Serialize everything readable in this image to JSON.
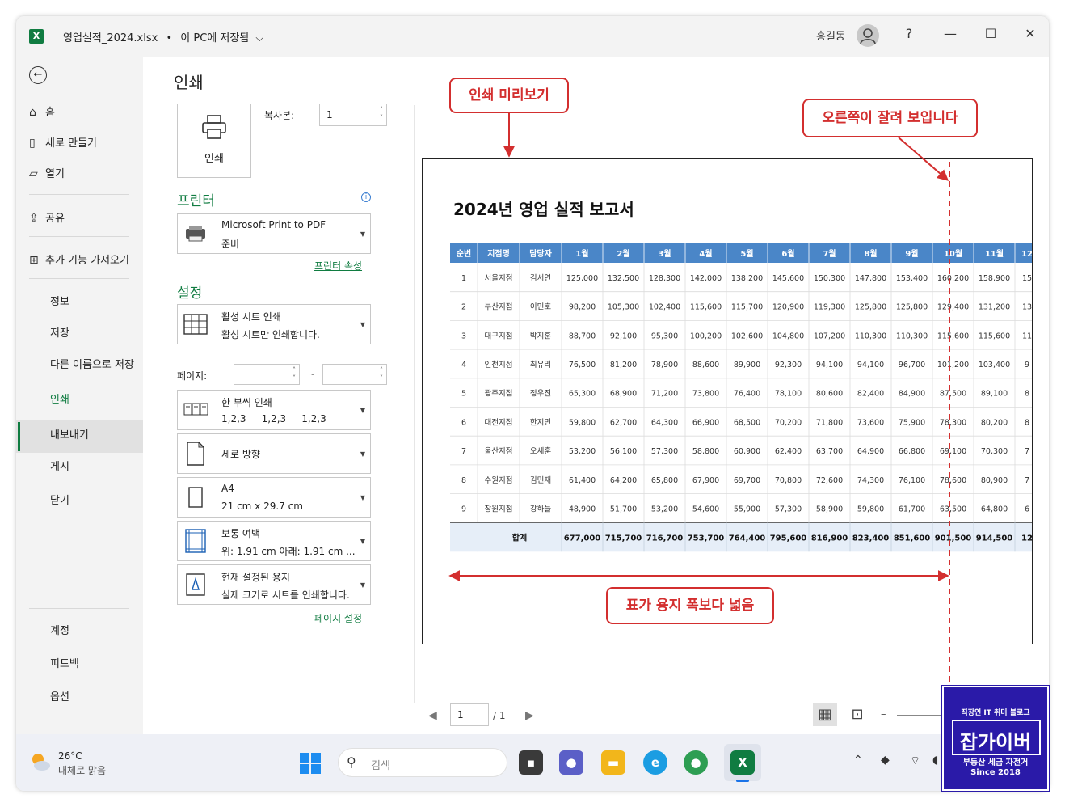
{
  "titlebar": {
    "filename": "영업실적_2024.xlsx",
    "separator": "•",
    "save_status": "이 PC에 저장됨",
    "dropdown_glyph": "⌵",
    "user": "홍길동",
    "help": "?",
    "minimize": "—",
    "maximize": "☐",
    "close": "✕"
  },
  "nav": {
    "back_glyph": "←",
    "items": [
      {
        "icon": "⌂",
        "label": "홈"
      },
      {
        "icon": "▯",
        "label": "새로 만들기"
      },
      {
        "icon": "▱",
        "label": "열기"
      },
      {
        "icon": "⇪",
        "label": "공유"
      },
      {
        "icon": "⊞",
        "label": "추가 기능 가져오기"
      }
    ],
    "plain_items": [
      "정보",
      "저장",
      "다른 이름으로 저장",
      "인쇄",
      "내보내기",
      "게시",
      "닫기"
    ],
    "bottom_items": [
      "계정",
      "피드백",
      "옵션"
    ],
    "active": "인쇄"
  },
  "print": {
    "title": "인쇄",
    "button_label": "인쇄",
    "copies_label": "복사본:",
    "copies_value": "1",
    "printer_section": "프린터",
    "printer_name": "Microsoft Print to PDF",
    "printer_status": "준비",
    "printer_props_link": "프린터 속성",
    "settings_section": "설정",
    "settings": [
      {
        "l1": "활성 시트 인쇄",
        "l2": "활성 시트만 인쇄합니다."
      },
      {
        "l1": "한 부씩 인쇄",
        "l2": "1,2,3     1,2,3     1,2,3"
      },
      {
        "l1": "세로 방향",
        "l2": ""
      },
      {
        "l1": "A4",
        "l2": "21 cm x 29.7 cm"
      },
      {
        "l1": "보통 여백",
        "l2": "위: 1.91 cm   아래: 1.91 cm ..."
      },
      {
        "l1": "현재 설정된 용지",
        "l2": "실제 크기로 시트를 인쇄합니다."
      }
    ],
    "pages_label": "페이지:",
    "pages_tilde": "~",
    "page_setup_link": "페이지 설정"
  },
  "preview": {
    "report_title": "2024년 영업 실적 보고서",
    "page_current": "1",
    "page_total": "/ 1"
  },
  "callouts": {
    "preview": "인쇄 미리보기",
    "cut": "오른쪽이 잘려 보입니다",
    "wide": "표가 용지 폭보다 넓음"
  },
  "chart_data": {
    "type": "table",
    "columns": [
      "순번",
      "지점명",
      "담당자",
      "1월",
      "2월",
      "3월",
      "4월",
      "5월",
      "6월",
      "7월",
      "8월",
      "9월",
      "10월",
      "11월",
      "12"
    ],
    "rows": [
      [
        "1",
        "서울지점",
        "김서연",
        "125,000",
        "132,500",
        "128,300",
        "142,000",
        "138,200",
        "145,600",
        "150,300",
        "147,800",
        "153,400",
        "160,200",
        "158,900",
        "15"
      ],
      [
        "2",
        "부산지점",
        "이민호",
        "98,200",
        "105,300",
        "102,400",
        "115,600",
        "115,700",
        "120,900",
        "119,300",
        "125,800",
        "125,800",
        "129,400",
        "131,200",
        "13"
      ],
      [
        "3",
        "대구지점",
        "박지훈",
        "88,700",
        "92,100",
        "95,300",
        "100,200",
        "102,600",
        "104,800",
        "107,200",
        "110,300",
        "110,300",
        "115,600",
        "115,600",
        "11"
      ],
      [
        "4",
        "인천지점",
        "최유리",
        "76,500",
        "81,200",
        "78,900",
        "88,600",
        "89,900",
        "92,300",
        "94,100",
        "94,100",
        "96,700",
        "101,200",
        "103,400",
        "9"
      ],
      [
        "5",
        "광주지점",
        "정우진",
        "65,300",
        "68,900",
        "71,200",
        "73,800",
        "76,400",
        "78,100",
        "80,600",
        "82,400",
        "84,900",
        "87,500",
        "89,100",
        "8"
      ],
      [
        "6",
        "대전지점",
        "한지민",
        "59,800",
        "62,700",
        "64,300",
        "66,900",
        "68,500",
        "70,200",
        "71,800",
        "73,600",
        "75,900",
        "78,300",
        "80,200",
        "8"
      ],
      [
        "7",
        "울산지점",
        "오세훈",
        "53,200",
        "56,100",
        "57,300",
        "58,800",
        "60,900",
        "62,400",
        "63,700",
        "64,900",
        "66,800",
        "69,100",
        "70,300",
        "7"
      ],
      [
        "8",
        "수원지점",
        "김민재",
        "61,400",
        "64,200",
        "65,800",
        "67,900",
        "69,700",
        "70,800",
        "72,600",
        "74,300",
        "76,100",
        "78,600",
        "80,900",
        "7"
      ],
      [
        "9",
        "창원지점",
        "강하늘",
        "48,900",
        "51,700",
        "53,200",
        "54,600",
        "55,900",
        "57,300",
        "58,900",
        "59,800",
        "61,700",
        "63,500",
        "64,800",
        "6"
      ]
    ],
    "total_label": "합계",
    "totals": [
      "677,000",
      "715,700",
      "716,700",
      "753,700",
      "764,400",
      "795,600",
      "816,900",
      "823,400",
      "851,600",
      "901,500",
      "914,500",
      "12"
    ],
    "header_color": "#4a86c8",
    "total_row_color": "#e6eef8"
  },
  "taskbar": {
    "temp": "26°C",
    "weather": "대체로 맑음",
    "search_placeholder": "검색"
  },
  "badge": {
    "line1": "직장인 IT 취미 블로그",
    "name": "잡가이버",
    "line2": "부동산 세금 자전거",
    "line3": "Since 2018"
  },
  "colors": {
    "excel_green": "#107c41",
    "callout_red": "#d32f2f",
    "badge_bg": "#2a1aa8"
  }
}
